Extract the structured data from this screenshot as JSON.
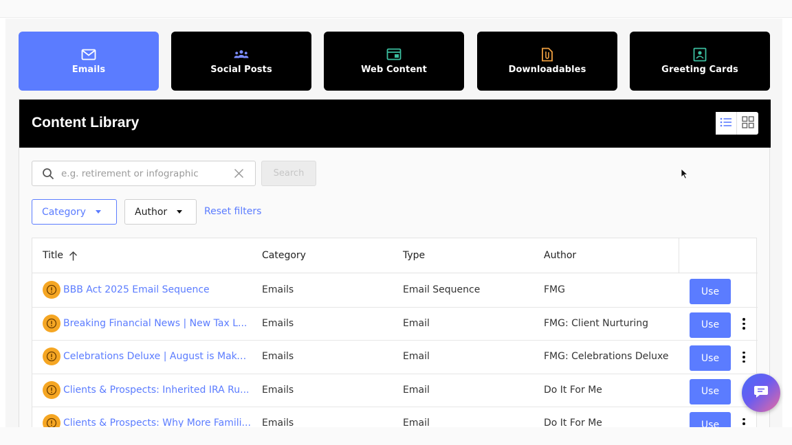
{
  "content_types": [
    {
      "label": "Emails",
      "icon": "envelope-icon",
      "active": true
    },
    {
      "label": "Social Posts",
      "icon": "people-icon",
      "active": false
    },
    {
      "label": "Web Content",
      "icon": "browser-window-icon",
      "active": false
    },
    {
      "label": "Downloadables",
      "icon": "paperclip-document-icon",
      "active": false
    },
    {
      "label": "Greeting Cards",
      "icon": "greeting-card-icon",
      "active": false
    }
  ],
  "library": {
    "title": "Content Library",
    "view_modes": [
      "list-view-icon",
      "grid-view-icon"
    ],
    "active_view": "list"
  },
  "search": {
    "placeholder": "e.g. retirement or infographic",
    "value": "",
    "button_label": "Search"
  },
  "filters": {
    "category_label": "Category",
    "author_label": "Author",
    "reset_label": "Reset filters"
  },
  "table": {
    "columns": [
      "Title",
      "Category",
      "Type",
      "Author"
    ],
    "sort": {
      "column": "Title",
      "direction": "ascending"
    },
    "rows": [
      {
        "title": "BBB Act 2025 Email Sequence",
        "category": "Emails",
        "type": "Email Sequence",
        "author": "FMG",
        "action": "Use",
        "has_menu": false
      },
      {
        "title": "Breaking Financial News | New Tax L...",
        "category": "Emails",
        "type": "Email",
        "author": "FMG: Client Nurturing",
        "action": "Use",
        "has_menu": true
      },
      {
        "title": "Celebrations Deluxe | August is Make...",
        "category": "Emails",
        "type": "Email",
        "author": "FMG: Celebrations Deluxe",
        "action": "Use",
        "has_menu": true
      },
      {
        "title": "Clients & Prospects: Inherited IRA Ru...",
        "category": "Emails",
        "type": "Email",
        "author": "Do It For Me",
        "action": "Use",
        "has_menu": false
      },
      {
        "title": "Clients & Prospects: Why More Famili...",
        "category": "Emails",
        "type": "Email",
        "author": "Do It For Me",
        "action": "Use",
        "has_menu": true
      }
    ]
  },
  "colors": {
    "accent": "#5b7cff",
    "header_bg": "#000000",
    "badge": "#f5a623",
    "chat_gradient_start": "#4a6cf7",
    "chat_gradient_end": "#e86aa0"
  },
  "chat_button_icon": "chat-bubble-icon"
}
